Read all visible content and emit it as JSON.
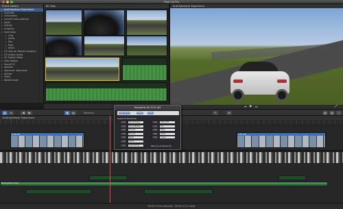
{
  "window": {
    "title": "Final Cut Pro"
  },
  "library": {
    "header": "Event Library",
    "items": [
      {
        "label": "Audi Sportscar Experience",
        "selected": true
      },
      {
        "label": "Calendar"
      },
      {
        "label": "Classmates"
      },
      {
        "label": "Concert Auto-stashed"
      },
      {
        "label": "DSLR"
      },
      {
        "label": "Factory"
      },
      {
        "label": "Graphics"
      },
      {
        "label": "Interviews"
      },
      {
        "label": "Orig"
      },
      {
        "label": "Audio"
      },
      {
        "label": "Run"
      },
      {
        "label": "Past"
      },
      {
        "label": "Stock"
      },
      {
        "label": "FX Clips for Motion Graphics"
      },
      {
        "label": "FX Gallery Audio"
      },
      {
        "label": "FX Gallery Video"
      },
      {
        "label": "Slow Motion"
      },
      {
        "label": "Sound FX"
      },
      {
        "label": "Speaker"
      },
      {
        "label": "Sportscar Interviews"
      },
      {
        "label": "Sunset"
      },
      {
        "label": "Trees"
      },
      {
        "label": "Walkthrough"
      }
    ]
  },
  "browser": {
    "header": "All Clips"
  },
  "viewer": {
    "header": "Audi Sportscar Experience"
  },
  "toolbar": {
    "center_label": "Retimed"
  },
  "timeline": {
    "header": "Audi Sportscar Experience",
    "audio_label": "Racing Rock Fade"
  },
  "statusbar": {
    "text": "00:00:33:04 selected - 00:01:11:11 total"
  },
  "keyword_hud": {
    "title": "Keywords for 9:24 AM",
    "tokens": [
      "Audi Aurora",
      "Credit",
      "Track"
    ],
    "shortcuts_label": "Keyword Shortcuts",
    "shortcuts": [
      {
        "key": "^1",
        "value": "Circuit Track"
      },
      {
        "key": "^2",
        "value": "Snow Mother"
      },
      {
        "key": "^3",
        "value": "Sunset"
      },
      {
        "key": "^4",
        "value": "Driving"
      },
      {
        "key": "^5",
        "value": "Paper"
      },
      {
        "key": "^6",
        "value": "Aerial"
      },
      {
        "key": "^7",
        "value": "Audi Aurora"
      },
      {
        "key": "^8",
        "value": "Dusk"
      },
      {
        "key": "^9",
        "value": "Dusk"
      }
    ],
    "shortcuts_right": [
      {
        "key": "^6",
        "value": "Carrar Rt"
      },
      {
        "key": "^7",
        "value": "Sun"
      },
      {
        "key": "^8",
        "value": "Daily"
      },
      {
        "key": "^9",
        "value": "Cards"
      },
      {
        "key": "^0",
        "value": "Logos"
      }
    ],
    "remove_label": "Remove All Keywords"
  },
  "timeline_clips": [
    {
      "label": "9:24 AM"
    },
    {
      "label": "9:27 AM"
    },
    {
      "label": "9:31 AM"
    }
  ],
  "colors": {
    "selection": "#e5b837",
    "accent": "#3d6fb3",
    "playhead": "#e54b4b"
  }
}
